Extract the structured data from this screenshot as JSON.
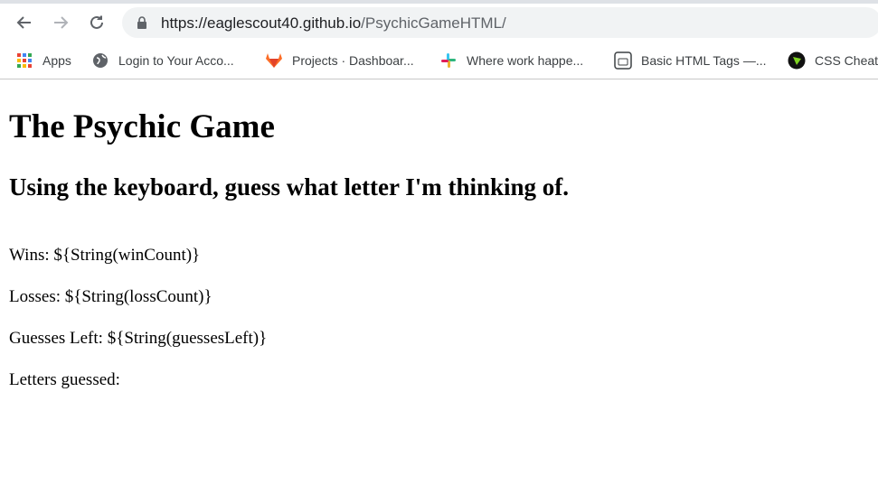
{
  "browser": {
    "url_host": "https://eaglescout40.github.io",
    "url_path": "/PsychicGameHTML/"
  },
  "bookmarks": [
    {
      "label": "Apps",
      "icon": "apps-grid-icon"
    },
    {
      "label": "Login to Your Acco...",
      "icon": "globe-icon"
    },
    {
      "label": "Projects · Dashboar...",
      "icon": "gitlab-icon"
    },
    {
      "label": "Where work happe...",
      "icon": "slack-icon"
    },
    {
      "label": "Basic HTML Tags —...",
      "icon": "html-doc-icon"
    },
    {
      "label": "CSS Cheat",
      "icon": "css-icon"
    }
  ],
  "page": {
    "title": "The Psychic Game",
    "subtitle": "Using the keyboard, guess what letter I'm thinking of.",
    "wins": "Wins: ${String(winCount)}",
    "losses": "Losses: ${String(lossCount)}",
    "guesses_left": "Guesses Left: ${String(guessesLeft)}",
    "letters_guessed": "Letters guessed:"
  }
}
